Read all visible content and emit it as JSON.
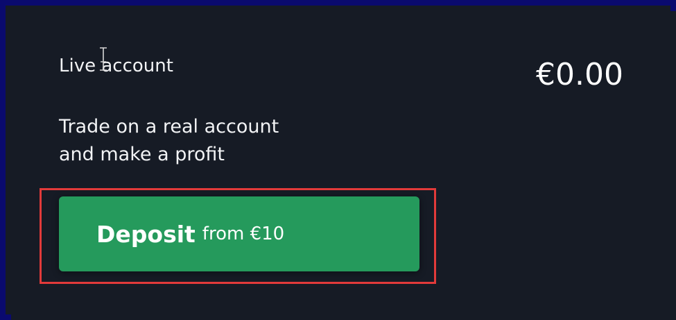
{
  "account": {
    "title": "Live account",
    "balance": "€0.00",
    "description": "Trade on a real account\nand make a profit"
  },
  "deposit_button": {
    "label": "Deposit",
    "sublabel": "from €10"
  },
  "colors": {
    "background": "#161b25",
    "frame": "#0a0a6e",
    "button": "#259a5c",
    "highlight": "#e23a3a"
  },
  "icons": {
    "cursor": "text-cursor-icon"
  }
}
